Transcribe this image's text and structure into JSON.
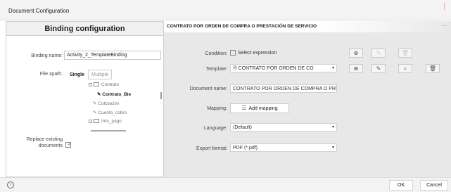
{
  "window": {
    "title": "Document Configuration"
  },
  "left": {
    "heading": "Binding configuration",
    "binding_name_label": "Binding name:",
    "binding_name_value": "Activity_2_TemplateBinding",
    "file_xpath_label": "File xpath:",
    "tabs": [
      "Single",
      "Multiple"
    ],
    "tree": {
      "contrato": "Contrato",
      "contrato_bie": "Contrato_Bie",
      "cotizacion": "Cotización",
      "cuenta_cobro": "Cuenta_cobro",
      "info_pago": "Info_pago"
    },
    "replace_label": "Replace existing documents"
  },
  "right": {
    "header": "CONTRATO POR ORDEN DE COMPRA O PRESTACIÓN DE SERVICIO",
    "condition_label": "Condition:",
    "condition_value": "Select expression",
    "template_label": "Template:",
    "template_value": "CONTRATO POR ORDEN DE CO",
    "docname_label": "Document name:",
    "docname_value": "CONTRATO POR ORDEN DE COMPRA O PRI",
    "mapping_label": "Mapping:",
    "mapping_button": "Add mapping",
    "language_label": "Language:",
    "language_value": "(Default)",
    "export_label": "Export format:",
    "export_value": "PDF (*.pdf)"
  },
  "footer": {
    "ok": "OK",
    "cancel": "Cancel"
  }
}
